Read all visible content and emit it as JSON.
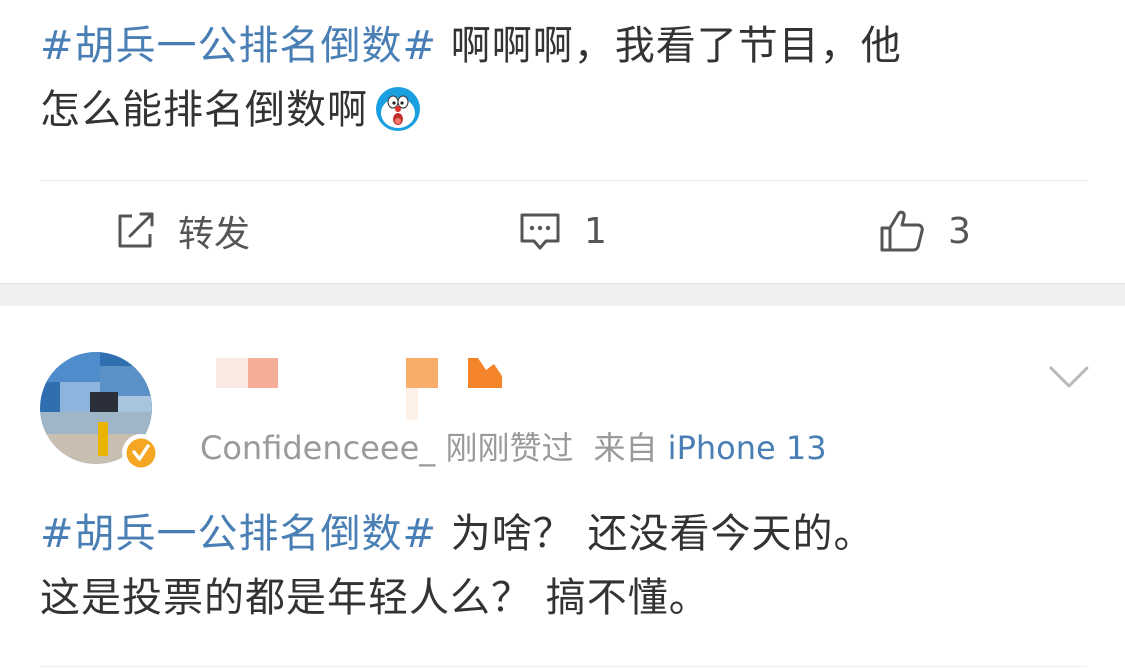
{
  "post_top": {
    "hashtag": "#胡兵一公排名倒数#",
    "text_line1": " 啊啊啊，我看了节目，他",
    "text_line2": "怎么能排名倒数啊",
    "emoji_icon": "doraemon-emoji-icon"
  },
  "action_bar": {
    "repost_label": "转发",
    "comment_count": "1",
    "like_count": "3"
  },
  "comment": {
    "username_masked": true,
    "meta_handle": "Confidenceee_",
    "meta_liked": "刚刚赞过",
    "meta_from": "来自",
    "meta_device": "iPhone 13",
    "hashtag": "#胡兵一公排名倒数#",
    "text_line1": " 为啥？ 还没看今天的。",
    "text_line2": "这是投票的都是年轻人么？ 搞不懂。"
  },
  "colors": {
    "link": "#4a7fb5",
    "text": "#333333",
    "meta": "#9a9a9a",
    "badge": "#f5a623",
    "gap": "#efefef"
  }
}
